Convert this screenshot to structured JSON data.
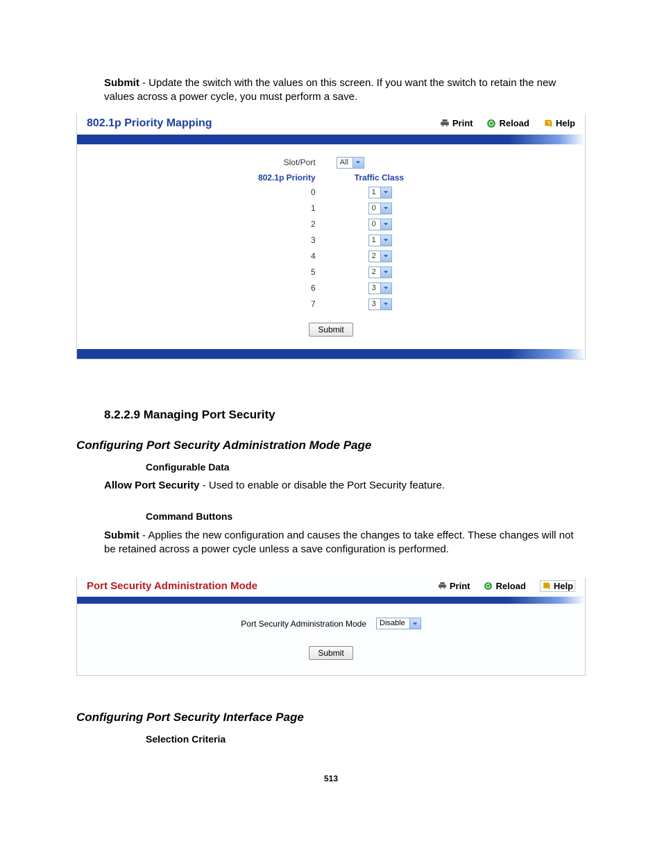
{
  "intro": {
    "submit_label": "Submit",
    "submit_desc": " - Update the switch with the values on this screen. If you want the switch to retain the new values across a power cycle, you must perform a save."
  },
  "panel1": {
    "title": "802.1p Priority Mapping",
    "actions": {
      "print": "Print",
      "reload": "Reload",
      "help": "Help"
    },
    "slotport_label": "Slot/Port",
    "slotport_value": "All",
    "col_priority": "802.1p Priority",
    "col_traffic": "Traffic Class",
    "rows": [
      {
        "p": "0",
        "t": "1"
      },
      {
        "p": "1",
        "t": "0"
      },
      {
        "p": "2",
        "t": "0"
      },
      {
        "p": "3",
        "t": "1"
      },
      {
        "p": "4",
        "t": "2"
      },
      {
        "p": "5",
        "t": "2"
      },
      {
        "p": "6",
        "t": "3"
      },
      {
        "p": "7",
        "t": "3"
      }
    ],
    "submit": "Submit"
  },
  "section": {
    "number": "8.2.2.9 ",
    "title": "Managing Port Security"
  },
  "sub1": {
    "heading": "Configuring Port Security Administration Mode Page",
    "conf_data": "Configurable Data",
    "allow_label": "Allow Port Security",
    "allow_desc": " - Used to enable or disable the Port Security feature.",
    "cmd_buttons": "Command Buttons",
    "submit_label": "Submit",
    "submit_desc": " - Applies the new configuration and causes the changes to take effect. These changes will not be retained across a power cycle unless a save configuration is performed."
  },
  "panel2": {
    "title": "Port Security Administration Mode",
    "actions": {
      "print": "Print",
      "reload": "Reload",
      "help": "Help"
    },
    "field_label": "Port Security Administration Mode",
    "field_value": "Disable",
    "submit": "Submit"
  },
  "sub2": {
    "heading": "Configuring Port Security Interface Page",
    "sel_criteria": "Selection Criteria"
  },
  "page_number": "513"
}
